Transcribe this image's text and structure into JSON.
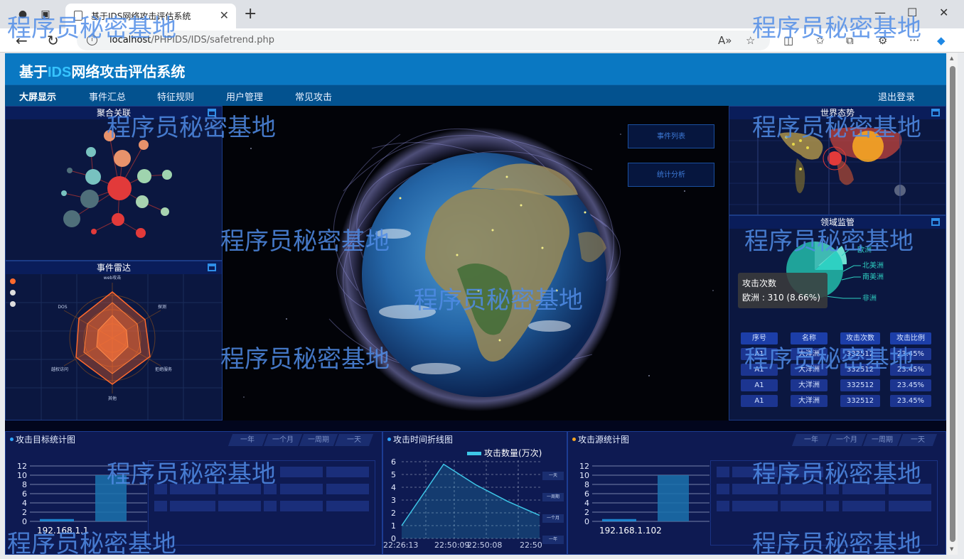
{
  "browser": {
    "tab_title": "基于IDS网络攻击评估系统",
    "url_host": "localhost",
    "url_path": "/PHPIDS/IDS/safetrend.php"
  },
  "header": {
    "title_prefix": "基于",
    "title_highlight": "IDS",
    "title_suffix": "网络攻击评估系统"
  },
  "menu": {
    "items": [
      "大屏显示",
      "事件汇总",
      "特征规则",
      "用户管理",
      "常见攻击"
    ],
    "logout": "退出登录"
  },
  "panels": {
    "cluster_title": "聚合关联",
    "radar_title": "事件雷达",
    "radar_labels": [
      "web攻击",
      "探测",
      "拒绝服务",
      "其他",
      "越权访问",
      "DOS"
    ],
    "attack_dist_title": "世界态势",
    "region_title": "领域监管"
  },
  "globe_buttons": [
    "事件列表",
    "统计分析"
  ],
  "region_pie": {
    "labels": [
      "欧洲",
      "北美洲",
      "南美洲",
      "非洲"
    ],
    "tooltip_title": "攻击次数",
    "tooltip_value": "欧洲 : 310 (8.66%)"
  },
  "region_table": {
    "headers": [
      "序号",
      "名称",
      "攻击次数",
      "攻击比例"
    ],
    "rows": [
      [
        "A1",
        "大洋洲",
        "332512",
        "23.45%"
      ],
      [
        "A1",
        "大洋洲",
        "332512",
        "23.45%"
      ],
      [
        "A1",
        "大洋洲",
        "332512",
        "23.45%"
      ],
      [
        "A1",
        "大洋洲",
        "332512",
        "23.45%"
      ]
    ]
  },
  "bottom": {
    "target_title": "攻击目标统计图",
    "timeline_title": "攻击时间折线图",
    "source_title": "攻击源统计图",
    "range_tabs": [
      "一年",
      "一个月",
      "一周期",
      "一天"
    ],
    "timeline_side_tabs": [
      "一天",
      "一周期",
      "一个月",
      "一年"
    ],
    "target_ip": "192.168.1.1",
    "source_ip": "192.168.1.102"
  },
  "watermark": "程序员秘密基地",
  "chart_data": [
    {
      "type": "bar",
      "categories": [
        "192.168.1.1",
        ""
      ],
      "values": [
        0.5,
        10
      ],
      "ylim": [
        0,
        12
      ],
      "yticks": [
        0,
        2,
        4,
        6,
        8,
        10,
        12
      ]
    },
    {
      "type": "line",
      "series": [
        {
          "name": "攻击数量(万次)",
          "values": [
            1,
            5.8,
            4.2,
            2.9,
            1.8
          ]
        }
      ],
      "x": [
        "22:26:13",
        "22:50:09",
        "22:50:08",
        "22:50:"
      ],
      "ylim": [
        0,
        6
      ],
      "yticks": [
        0,
        1,
        2,
        3,
        4,
        5,
        6
      ]
    },
    {
      "type": "bar",
      "categories": [
        "192.168.1.102",
        ""
      ],
      "values": [
        0.5,
        10
      ],
      "ylim": [
        0,
        12
      ],
      "yticks": [
        0,
        2,
        4,
        6,
        8,
        10,
        12
      ]
    }
  ]
}
